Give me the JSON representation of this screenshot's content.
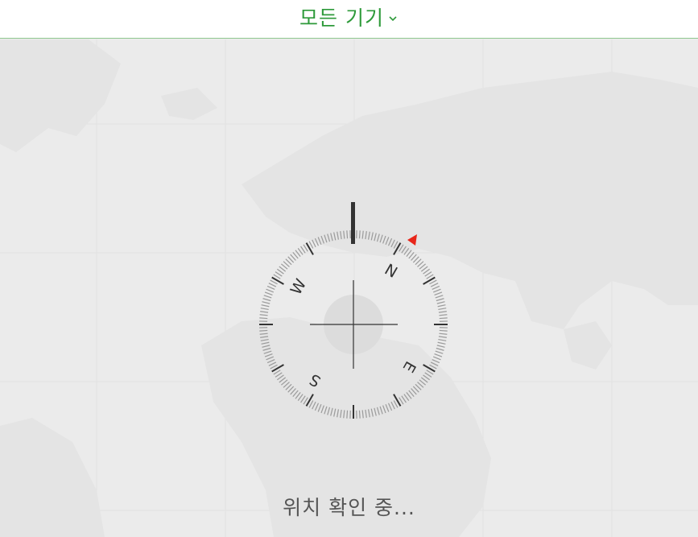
{
  "header": {
    "title": "모든 기기",
    "chevron_icon": "chevron-down-icon"
  },
  "compass": {
    "labels": {
      "north": "N",
      "east": "E",
      "south": "S",
      "west": "W"
    },
    "pointer_color": "#e8261a"
  },
  "status": {
    "text": "위치 확인 중..."
  },
  "colors": {
    "accent": "#2e9a3a",
    "header_border": "#8ec78e"
  }
}
